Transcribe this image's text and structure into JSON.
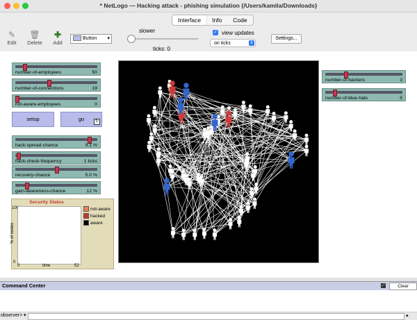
{
  "window": {
    "title": "* NetLogo — Hacking attack - phishing simulation {/Users/kamila/Downloads}"
  },
  "tabs": [
    "Interface",
    "Info",
    "Code"
  ],
  "toolbar": {
    "edit_label": "Edit",
    "delete_label": "Delete",
    "add_label": "Add",
    "widget_type": "Button",
    "speed_label": "slower",
    "ticks_label": "ticks: 0",
    "view_updates_label": "view updates",
    "update_mode": "on ticks",
    "settings_label": "Settings..."
  },
  "sliders_left": [
    {
      "label": "number-of-employees",
      "value": "50",
      "fraction": 0.1
    },
    {
      "label": "number-of-connections",
      "value": "19",
      "fraction": 0.4
    },
    {
      "label": "not-aware-employees",
      "value": "0",
      "fraction": 0.0
    },
    {
      "label": "hack-spread-chance",
      "value": "9.1 %",
      "fraction": 0.91
    },
    {
      "label": "hack-check-frequency",
      "value": "1 ticks",
      "fraction": 0.02
    },
    {
      "label": "recovery-chance",
      "value": "5.0 %",
      "fraction": 0.5
    },
    {
      "label": "gain-awareness-chance",
      "value": "12 %",
      "fraction": 0.12
    }
  ],
  "sliders_right": [
    {
      "label": "number-of-hackers",
      "value": "3",
      "fraction": 0.25
    },
    {
      "label": "number-of-blue-hats",
      "value": "5",
      "fraction": 0.1
    }
  ],
  "buttons": {
    "setup": "setup",
    "go": "go"
  },
  "plot": {
    "title": "Security Status",
    "ylabel": "% of nodes",
    "xlabel": "time",
    "ymax": "100",
    "ymin": "0",
    "xmin": "0",
    "xmax": "52",
    "legend": [
      {
        "label": "not-aware",
        "color": "#e8825a"
      },
      {
        "label": "hacked",
        "color": "#c0392b"
      },
      {
        "label": "aware",
        "color": "#000000"
      }
    ]
  },
  "command_center": {
    "title": "Command Center",
    "clear_label": "Clear",
    "prompt": "observer>"
  },
  "colors": {
    "slider": "#8db9b0",
    "button": "#b9bcea",
    "hacker": "#d03a3a",
    "blue_hat": "#3366cc",
    "employee": "#ffffff"
  }
}
